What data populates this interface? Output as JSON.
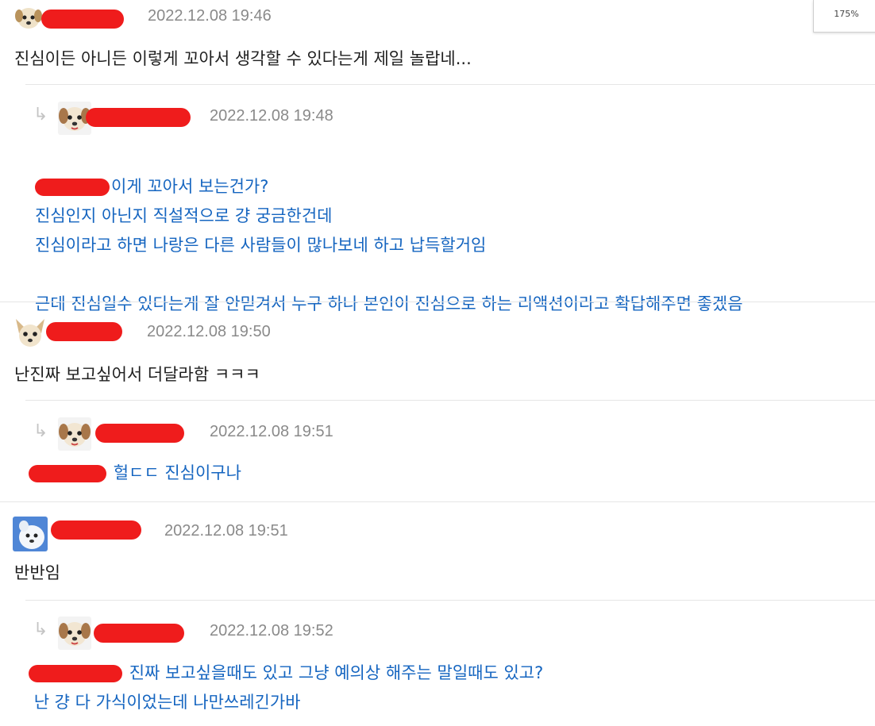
{
  "zoom_level": "175%",
  "comments": [
    {
      "timestamp": "2022.12.08 19:46",
      "lines": [
        "진심이든 아니든 이렇게 꼬아서 생각할 수 있다는게 제일 놀랍네..."
      ]
    },
    {
      "timestamp": "2022.12.08 19:48",
      "first_line": "이게 꼬아서 보는건가?",
      "lines": [
        "진심인지 아닌지 직설적으로 걍 궁금한건데",
        "진심이라고 하면 나랑은 다른 사람들이 많나보네 하고 납득할거임",
        "",
        "근데 진심일수 있다는게 잘 안믿겨서 누구 하나 본인이 진심으로 하는 리액션이라고 확답해주면 좋겠음"
      ]
    },
    {
      "timestamp": "2022.12.08 19:50",
      "lines": [
        "난진짜 보고싶어서 더달라함 ㅋㅋㅋ"
      ]
    },
    {
      "timestamp": "2022.12.08 19:51",
      "first_line": "헐ㄷㄷ 진심이구나"
    },
    {
      "timestamp": "2022.12.08 19:51",
      "lines": [
        "반반임"
      ]
    },
    {
      "timestamp": "2022.12.08 19:52",
      "first_line": "진짜 보고싶을때도 있고 그냥 예의상 해주는 말일때도 있고?",
      "lines": [
        "난 걍 다 가식이었는데 나만쓰레긴가바"
      ]
    }
  ],
  "colors": {
    "reply_text": "#1565c0",
    "redaction": "#ef1c1c",
    "timestamp": "#8a8a8a"
  },
  "icons": [
    "reply-arrow-icon",
    "puppy-avatar-icon",
    "chihuahua-avatar-icon",
    "white-dog-avatar-icon"
  ]
}
